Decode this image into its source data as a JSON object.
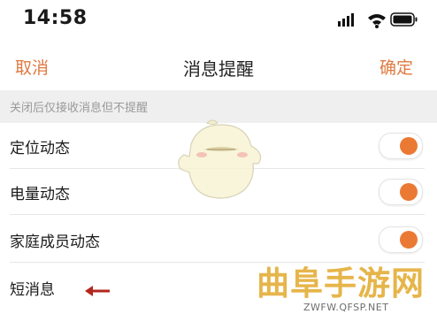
{
  "status_bar": {
    "time": "14:58",
    "icons": [
      "signal-icon",
      "wifi-icon",
      "battery-icon"
    ]
  },
  "nav": {
    "cancel": "取消",
    "title": "消息提醒",
    "confirm": "确定"
  },
  "hint": "关闭后仅接收消息但不提醒",
  "settings": [
    {
      "label": "定位动态",
      "enabled": true
    },
    {
      "label": "电量动态",
      "enabled": true
    },
    {
      "label": "家庭成员动态",
      "enabled": true
    },
    {
      "label": "短消息",
      "enabled": null
    }
  ],
  "watermark": {
    "text": "曲阜手游网",
    "url": "ZWFW.QFSP.NET"
  },
  "colors": {
    "accent": "#ea7a33",
    "nav_link": "#e07a40",
    "hint_bg": "#efefef",
    "annotation_arrow": "#b3261e",
    "watermark": "#e6b54a"
  }
}
